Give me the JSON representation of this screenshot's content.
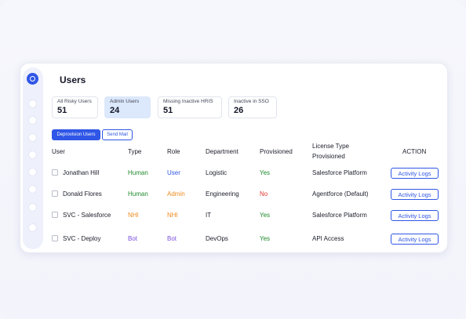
{
  "page": {
    "title": "Users"
  },
  "stats": [
    {
      "label": "All Risky Users",
      "value": "51",
      "active": false
    },
    {
      "label": "Admin Users",
      "value": "24",
      "active": true
    },
    {
      "label": "Missing Inactive HRIS",
      "value": "51",
      "active": false
    },
    {
      "label": "Inactive in SSO",
      "value": "26",
      "active": false
    }
  ],
  "actions": {
    "deprovision": "Deprovision Users",
    "send_mail": "Send Mail"
  },
  "table": {
    "headers": {
      "user": "User",
      "type": "Type",
      "role": "Role",
      "department": "Department",
      "provisioned": "Provisioned",
      "license_line1": "License Type",
      "license_line2": "Provisioned",
      "action": "ACTION"
    },
    "rows": [
      {
        "user": "Jonathan Hill",
        "type": "Human",
        "role": "User",
        "department": "Logistic",
        "provisioned": "Yes",
        "license": "Salesforce Platform",
        "action": "Activity Logs"
      },
      {
        "user": "Donald Flores",
        "type": "Human",
        "role": "Admin",
        "department": "Engineering",
        "provisioned": "No",
        "license": "Agentforce (Default)",
        "action": "Activity Logs"
      },
      {
        "user": "SVC - Salesforce",
        "type": "NHI",
        "role": "NHI",
        "department": "IT",
        "provisioned": "Yes",
        "license": "Salesforce Platform",
        "action": "Activity Logs"
      },
      {
        "user": "SVC - Deploy",
        "type": "Bot",
        "role": "Bot",
        "department": "DevOps",
        "provisioned": "Yes",
        "license": "API Access",
        "action": "Activity Logs"
      }
    ]
  },
  "sidebar": {
    "logo_icon": "logo-ring-icon",
    "nav_icons": [
      "nav-dot-icon",
      "nav-dot-icon",
      "nav-dot-icon",
      "nav-dot-icon",
      "nav-dot-icon",
      "nav-dot-icon",
      "nav-dot-icon",
      "nav-dot-icon"
    ]
  },
  "colors": {
    "accent": "#2f56e6",
    "human": "#1f8a2b",
    "user_role": "#2f56e6",
    "admin_role": "#f08a1c",
    "nhi": "#f08a1c",
    "bot": "#7b4fe0",
    "yes": "#1f8a2b",
    "no": "#e0362c"
  }
}
